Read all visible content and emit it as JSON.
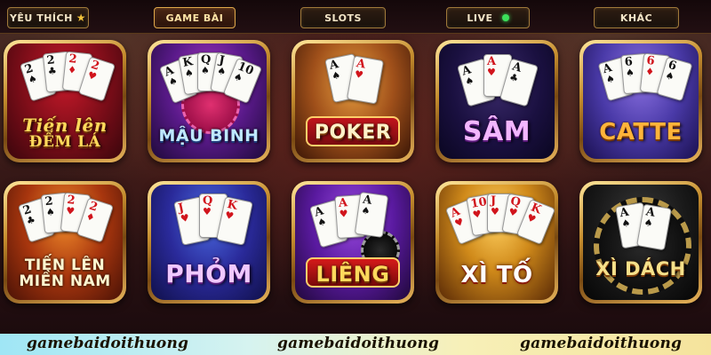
{
  "nav": {
    "tabs": [
      {
        "label": "YÊU THÍCH",
        "icon": "star-icon"
      },
      {
        "label": "GAME BÀI",
        "active": true
      },
      {
        "label": "SLOTS"
      },
      {
        "label": "LIVE",
        "indicator": "live-dot-icon"
      },
      {
        "label": "KHÁC"
      }
    ]
  },
  "games": [
    {
      "line1": "Tiến lên",
      "line2": "ĐẾM LÁ",
      "cards": [
        {
          "r": "2",
          "s": "♠"
        },
        {
          "r": "2",
          "s": "♣"
        },
        {
          "r": "2",
          "s": "♦"
        },
        {
          "r": "2",
          "s": "♥"
        }
      ]
    },
    {
      "line1": "MẬU BINH",
      "line2": "",
      "cards": [
        {
          "r": "A",
          "s": "♠"
        },
        {
          "r": "K",
          "s": "♠"
        },
        {
          "r": "Q",
          "s": "♠"
        },
        {
          "r": "J",
          "s": "♠"
        },
        {
          "r": "10",
          "s": "♠"
        }
      ]
    },
    {
      "line1": "POKER",
      "line2": "",
      "cards": [
        {
          "r": "A",
          "s": "♠"
        },
        {
          "r": "A",
          "s": "♥"
        }
      ]
    },
    {
      "line1": "SÂM",
      "line2": "",
      "cards": [
        {
          "r": "A",
          "s": "♠"
        },
        {
          "r": "A",
          "s": "♥"
        },
        {
          "r": "A",
          "s": "♣"
        }
      ]
    },
    {
      "line1": "CATTE",
      "line2": "",
      "cards": [
        {
          "r": "A",
          "s": "♠"
        },
        {
          "r": "6",
          "s": "♠"
        },
        {
          "r": "6",
          "s": "♦"
        },
        {
          "r": "6",
          "s": "♠"
        }
      ]
    },
    {
      "line1": "TIẾN LÊN",
      "line2": "MIỀN NAM",
      "cards": [
        {
          "r": "2",
          "s": "♣"
        },
        {
          "r": "2",
          "s": "♠"
        },
        {
          "r": "2",
          "s": "♥"
        },
        {
          "r": "2",
          "s": "♦"
        }
      ]
    },
    {
      "line1": "PHỎM",
      "line2": "",
      "cards": [
        {
          "r": "J",
          "s": "♥"
        },
        {
          "r": "Q",
          "s": "♥"
        },
        {
          "r": "K",
          "s": "♥"
        }
      ]
    },
    {
      "line1": "LIÊNG",
      "line2": "",
      "cards": [
        {
          "r": "A",
          "s": "♠"
        },
        {
          "r": "A",
          "s": "♥"
        },
        {
          "r": "A",
          "s": "♠"
        }
      ]
    },
    {
      "line1": "XÌ TỐ",
      "line2": "",
      "cards": [
        {
          "r": "A",
          "s": "♥"
        },
        {
          "r": "10",
          "s": "♥"
        },
        {
          "r": "J",
          "s": "♥"
        },
        {
          "r": "Q",
          "s": "♥"
        },
        {
          "r": "K",
          "s": "♥"
        }
      ]
    },
    {
      "line1": "XÌ DÁCH",
      "line2": "",
      "cards": [
        {
          "r": "A",
          "s": "♠"
        },
        {
          "r": "A",
          "s": "♠"
        }
      ]
    }
  ],
  "footer": {
    "watermarks": [
      "gamebaidoithuong",
      "gamebaidoithuong",
      "gamebaidoithuong"
    ]
  }
}
